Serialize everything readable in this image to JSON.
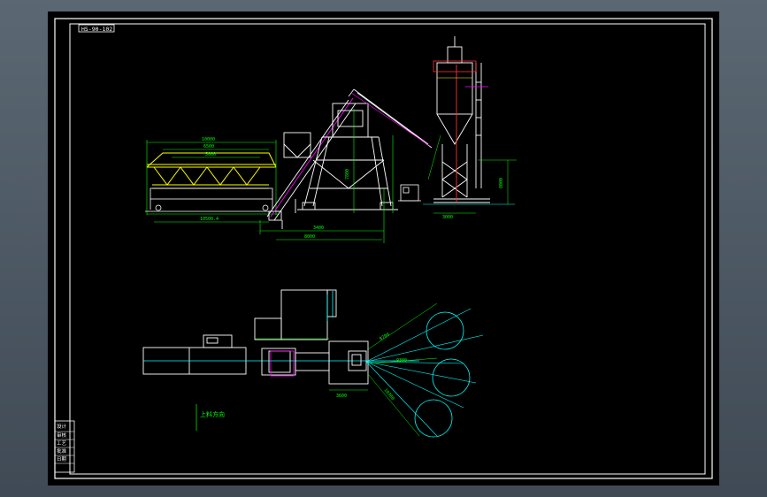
{
  "drawing": {
    "title_block_text": "HS-90-102",
    "plan_view_label": "上料方向",
    "dimension_labels": {
      "hopper_width": "10000",
      "hopper_mid": "6500",
      "hopper_inner": "5000",
      "hopper_base": "10500.4",
      "conveyor_run": "3400",
      "plant_span": "8000",
      "mixer_height": "7800",
      "silo_height": "8000",
      "silo_base": "3000",
      "side_gap": "3600",
      "arc_radius_1": "8700",
      "arc_radius_2": "9300",
      "arc_radius_3": "10300"
    },
    "revision_block": [
      "设计",
      "审核",
      "工艺",
      "批准",
      "日期"
    ],
    "colors": {
      "background": "#000000",
      "frame": "#ffffff",
      "structure": "#ffffff",
      "dimension": "#00ff00",
      "axis": "#00ffff",
      "conveyor": "#ff00ff",
      "hopper": "#ffff00",
      "silo_mark": "#ff3030"
    }
  }
}
